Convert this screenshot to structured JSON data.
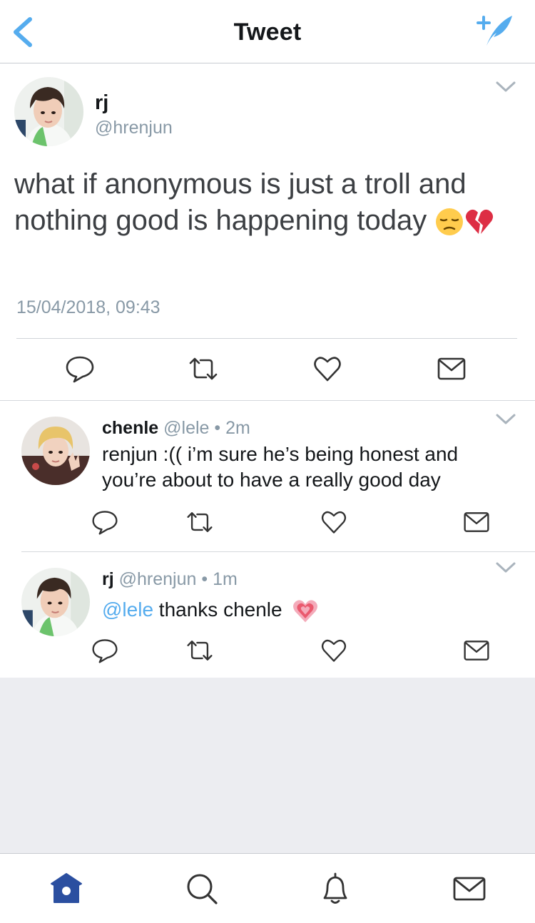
{
  "header": {
    "title": "Tweet",
    "back_icon": "chevron-left-icon",
    "compose_icon": "compose-tweet-icon"
  },
  "colors": {
    "accent": "#55acee",
    "muted": "#8899a6",
    "tab_active": "#2b4fa0",
    "background_gray": "#ecedf1"
  },
  "tweet": {
    "name": "rj",
    "handle": "@hrenjun",
    "text": "what if anonymous is just a troll and nothing good is happening today",
    "emojis": [
      "pensive-face-emoji",
      "broken-heart-emoji"
    ],
    "timestamp": "15/04/2018, 09:43"
  },
  "replies": [
    {
      "name": "chenle",
      "handle": "@lele",
      "time": "• 2m",
      "text": "renjun :(( i’m sure he’s being honest and you’re about to have a really good day"
    },
    {
      "name": "rj",
      "handle": "@hrenjun",
      "time": "• 1m",
      "mention": "@lele",
      "text": " thanks chenle",
      "emoji": "pink-heart-emoji"
    }
  ],
  "tabbar": {
    "items": [
      "home",
      "search",
      "notifications",
      "messages"
    ],
    "active": "home"
  }
}
